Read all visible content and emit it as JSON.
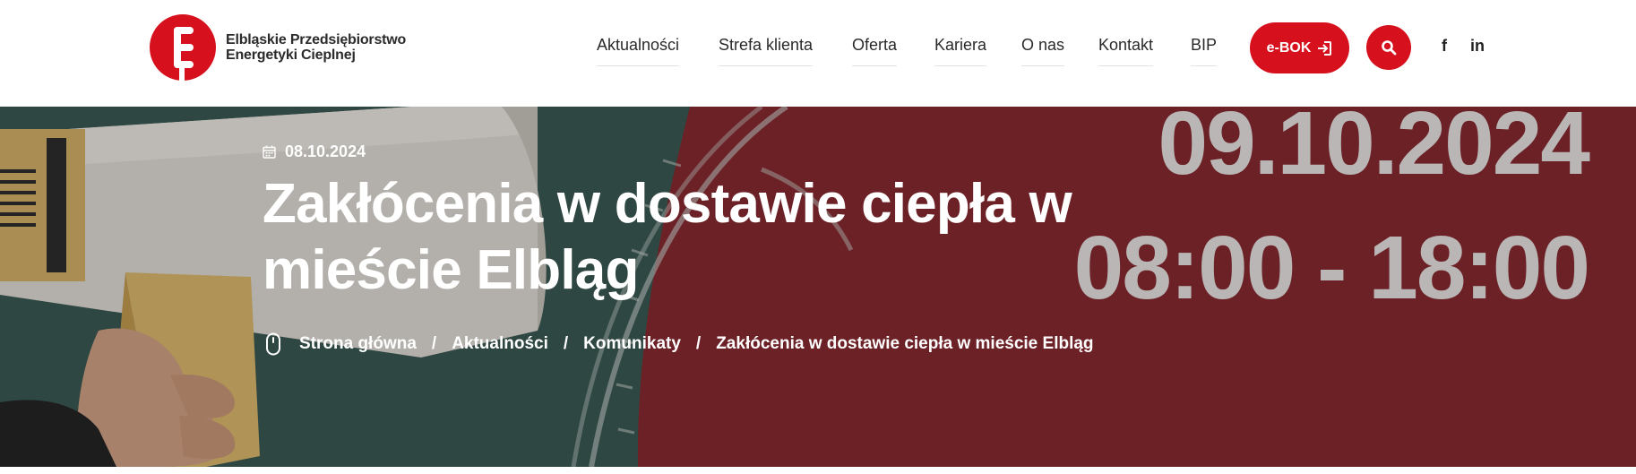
{
  "header": {
    "logo_text_line1": "Elbląskie Przedsiębiorstwo",
    "logo_text_line2": "Energetyki Cieplnej",
    "nav": [
      {
        "label": "Aktualności"
      },
      {
        "label": "Strefa klienta"
      },
      {
        "label": "Oferta"
      },
      {
        "label": "Kariera"
      },
      {
        "label": "O nas"
      },
      {
        "label": "Kontakt"
      },
      {
        "label": "BIP"
      }
    ],
    "ebok_label": "e-BOK",
    "social": {
      "facebook": "f",
      "linkedin": "in"
    }
  },
  "hero": {
    "overlay_date": "09.10.2024",
    "overlay_time": "08:00 - 18:00",
    "post_date": "08.10.2024",
    "title": "Zakłócenia w dostawie ciepła w mieście Elbląg",
    "breadcrumbs": [
      "Strona główna",
      "Aktualności",
      "Komunikaty",
      "Zakłócenia w dostawie ciepła w mieście Elbląg"
    ],
    "breadcrumb_separator": "/"
  },
  "colors": {
    "brand_red": "#d6111d",
    "panel_red": "#8b2b31",
    "board_green": "#3b5a52"
  }
}
